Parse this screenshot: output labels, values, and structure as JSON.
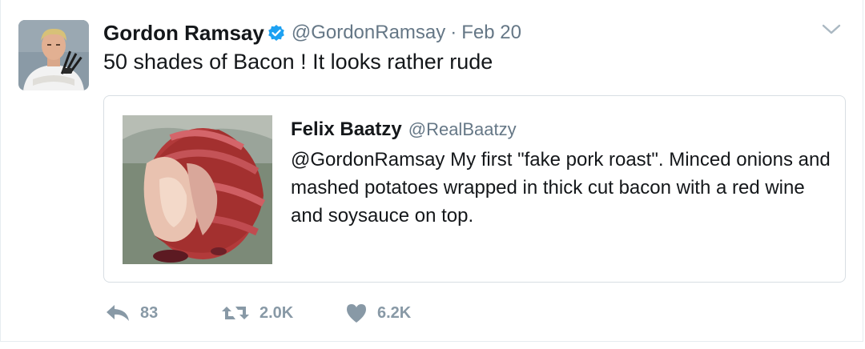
{
  "author": {
    "name": "Gordon Ramsay",
    "handle": "@GordonRamsay",
    "separator": "·",
    "date": "Feb 20",
    "verified": true,
    "avatar_icon": "avatar-image"
  },
  "tweet": {
    "text": "50 shades of Bacon ! It looks rather rude"
  },
  "quote": {
    "name": "Felix Baatzy",
    "handle": "@RealBaatzy",
    "text": "@GordonRamsay My first \"fake pork roast\". Minced onions and mashed potatoes wrapped in thick cut bacon with a red wine and soysauce on top.",
    "media_icon": "food-photo"
  },
  "actions": {
    "reply_count": "83",
    "retweet_count": "2.0K",
    "like_count": "6.2K"
  },
  "colors": {
    "verified": "#1da1f2",
    "muted": "#657786",
    "action": "#8899a6",
    "border": "#e6ecf0"
  }
}
